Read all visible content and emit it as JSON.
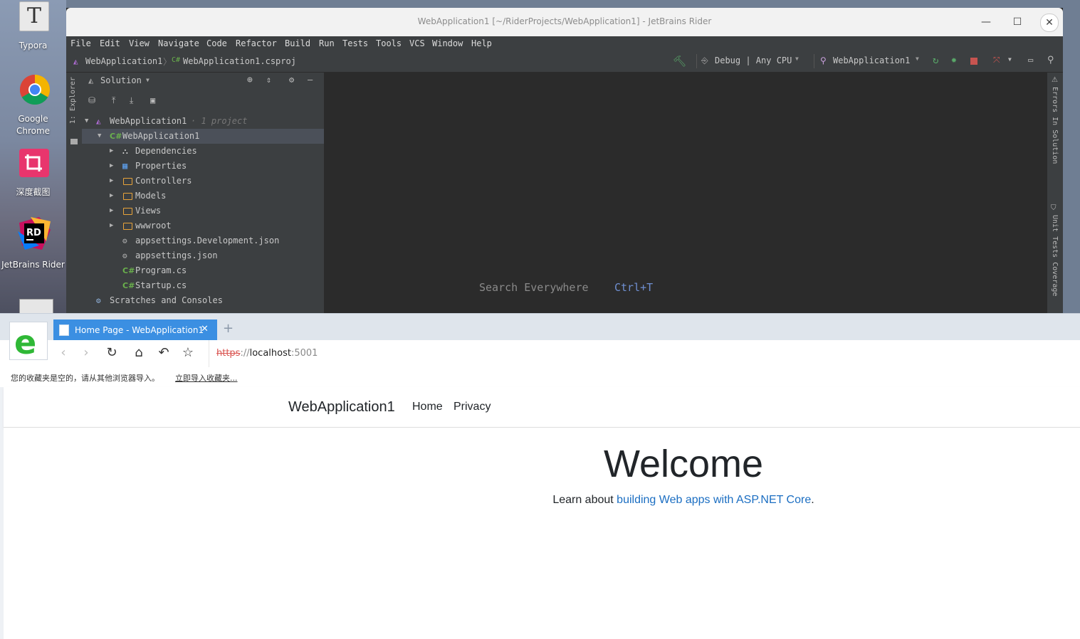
{
  "desktop": {
    "icons": [
      {
        "label": "Typora",
        "icon": "typora-icon"
      },
      {
        "label": "Google Chrome",
        "icon": "chrome-icon"
      },
      {
        "label": "深度截图",
        "icon": "screenshot-icon"
      },
      {
        "label": "JetBrains Rider",
        "icon": "rider-icon"
      }
    ]
  },
  "ide": {
    "title": "WebApplication1 [~/RiderProjects/WebApplication1] - JetBrains Rider",
    "menu": [
      "File",
      "Edit",
      "View",
      "Navigate",
      "Code",
      "Refactor",
      "Build",
      "Run",
      "Tests",
      "Tools",
      "VCS",
      "Window",
      "Help"
    ],
    "breadcrumb": [
      "WebApplication1",
      "WebApplication1.csproj"
    ],
    "config": "Debug | Any CPU",
    "run_target": "WebApplication1",
    "left_tool_label": "1: Explorer",
    "panel_title": "Solution",
    "tree": {
      "solution": "WebApplication1",
      "solution_note": "· 1 project",
      "project": "WebApplication1",
      "items": [
        "Dependencies",
        "Properties",
        "Controllers",
        "Models",
        "Views",
        "wwwroot",
        "appsettings.Development.json",
        "appsettings.json",
        "Program.cs",
        "Startup.cs"
      ],
      "scratches": "Scratches and Consoles"
    },
    "editor_hint": "Search Everywhere",
    "editor_shortcut": "Ctrl+T",
    "right_tools": [
      "Errors In Solution",
      "Unit Tests Coverage"
    ],
    "colors": {
      "accent_green": "#59a869",
      "stop_red": "#c75450",
      "shortcut_blue": "#6f8fd1"
    }
  },
  "browser": {
    "tab_title": "Home Page - WebApplication1",
    "url_scheme": "https",
    "url_sep": "://",
    "url_host": "localhost",
    "url_port": ":5001",
    "bookmarks_msg": "您的收藏夹是空的，请从其他浏览器导入。",
    "bookmarks_link": "立即导入收藏夹...",
    "site": {
      "brand": "WebApplication1",
      "nav": [
        "Home",
        "Privacy"
      ],
      "heading": "Welcome",
      "learn_prefix": "Learn about ",
      "learn_link": "building Web apps with ASP.NET Core",
      "learn_suffix": "."
    },
    "colors": {
      "tab_blue": "#3b8fe2",
      "link_blue": "#1b6ec2",
      "logo_green": "#2fb836"
    }
  }
}
